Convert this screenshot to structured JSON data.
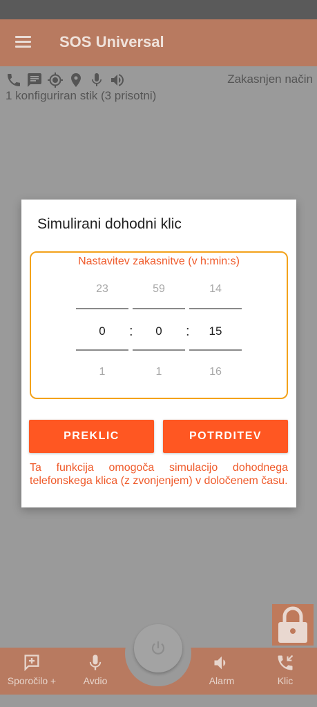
{
  "app": {
    "title": "SOS Universal"
  },
  "status": {
    "mode": "Zakasnjen način",
    "configured": "1 konfiguriran stik (3 prisotni)",
    "icons": [
      "phone-icon",
      "message-icon",
      "gps-target-icon",
      "location-pin-icon",
      "microphone-icon",
      "speaker-icon"
    ]
  },
  "dialog": {
    "title": "Simulirani dohodni klic",
    "picker_label": "Nastavitev zakasnitve (v h:min:s)",
    "hours": {
      "prev": "23",
      "current": "0",
      "next": "1"
    },
    "minutes": {
      "prev": "59",
      "current": "0",
      "next": "1"
    },
    "seconds": {
      "prev": "14",
      "current": "15",
      "next": "16"
    },
    "separator": ":",
    "cancel_label": "PREKLIC",
    "confirm_label": "POTRDITEV",
    "info": "Ta funkcija omogoča simulacijo dohodnega telefonskega klica (z zvonjenjem) v določenem času."
  },
  "nav": {
    "message_label": "Sporočilo +",
    "audio_label": "Avdio",
    "alarm_label": "Alarm",
    "call_label": "Klic"
  },
  "colors": {
    "accent": "#ff5722",
    "picker_border": "#f3a21a",
    "appbar_dimmed": "#b87a60"
  }
}
